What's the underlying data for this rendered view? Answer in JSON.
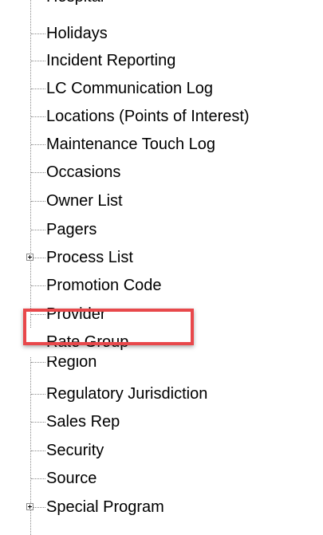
{
  "colors": {
    "background": "#ffffff",
    "text": "#000000",
    "tree_line": "#8a8a8a",
    "highlight_border": "#e8484b"
  },
  "tree": {
    "partial_top_label": "Hospital",
    "items": [
      {
        "label": "Holidays",
        "expandable": false
      },
      {
        "label": "Incident Reporting",
        "expandable": false
      },
      {
        "label": "LC Communication Log",
        "expandable": false
      },
      {
        "label": "Locations (Points of Interest)",
        "expandable": false
      },
      {
        "label": "Maintenance Touch Log",
        "expandable": false
      },
      {
        "label": "Occasions",
        "expandable": false
      },
      {
        "label": "Owner List",
        "expandable": false
      },
      {
        "label": "Pagers",
        "expandable": false
      },
      {
        "label": "Process List",
        "expandable": true,
        "expander_icon": "plus-box-icon"
      },
      {
        "label": "Promotion Code",
        "expandable": false
      },
      {
        "label": "Provider",
        "expandable": false
      },
      {
        "label": "Rate Group",
        "expandable": false,
        "highlighted": true
      },
      {
        "label": "Region",
        "expandable": false
      },
      {
        "label": "Regulatory Jurisdiction",
        "expandable": false
      },
      {
        "label": "Sales Rep",
        "expandable": false
      },
      {
        "label": "Security",
        "expandable": false
      },
      {
        "label": "Source",
        "expandable": false
      },
      {
        "label": "Special Program",
        "expandable": true,
        "expander_icon": "plus-box-icon"
      }
    ]
  }
}
